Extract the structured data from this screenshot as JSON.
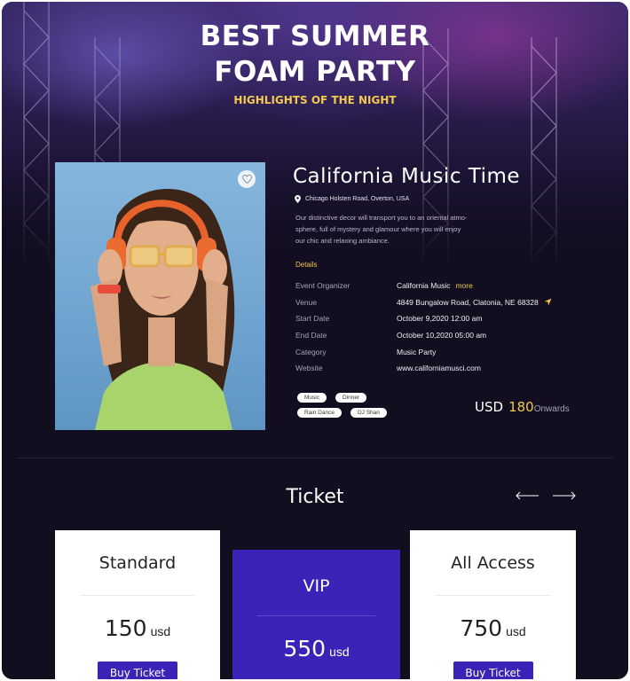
{
  "hero": {
    "title_line1": "BEST SUMMER",
    "title_line2": "FOAM PARTY",
    "subtitle": "HIGHLIGHTS OF THE NIGHT"
  },
  "event": {
    "title": "California Music Time",
    "location": "Chicago Holsten Road, Overton, USA",
    "location_icon": "map-pin-icon",
    "favorite_icon": "heart-icon",
    "description_lines": [
      "Our distinctive decor will transport you to an oriental atmo-",
      "sphere, full of mystery and glamour where you will enjoy",
      "our chic and relaxing ambiance."
    ],
    "details_heading": "Details",
    "details": [
      {
        "key": "Event Organizer",
        "value": "California Music",
        "extra": "more"
      },
      {
        "key": "Venue",
        "value": "4849 Bungalow Road, Clatonia, NE 68328",
        "icon": "navigate-arrow-icon"
      },
      {
        "key": "Start Date",
        "value": "October 9,2020 12:00 am"
      },
      {
        "key": "End Date",
        "value": "October 10,2020 05:00 am"
      },
      {
        "key": "Category",
        "value": "Music Party"
      },
      {
        "key": "Website",
        "value": "www.californiamusci.com"
      }
    ],
    "tags": [
      "Music",
      "Dinner",
      "Rain Dance",
      "DJ Shan"
    ],
    "price": {
      "currency": "USD",
      "amount": "180",
      "suffix": "Onwards"
    }
  },
  "tickets": {
    "heading": "Ticket",
    "prev_icon": "arrow-left-icon",
    "next_icon": "arrow-right-icon",
    "cards": [
      {
        "name": "Standard",
        "price": "150",
        "unit": "usd",
        "button": "Buy Ticket"
      },
      {
        "name": "VIP",
        "price": "550",
        "unit": "usd"
      },
      {
        "name": "All Access",
        "price": "750",
        "unit": "usd",
        "button": "Buy Ticket"
      }
    ]
  },
  "colors": {
    "accent_gold": "#f2c94c",
    "brand_purple": "#3c23b8",
    "background": "#120d1f"
  }
}
